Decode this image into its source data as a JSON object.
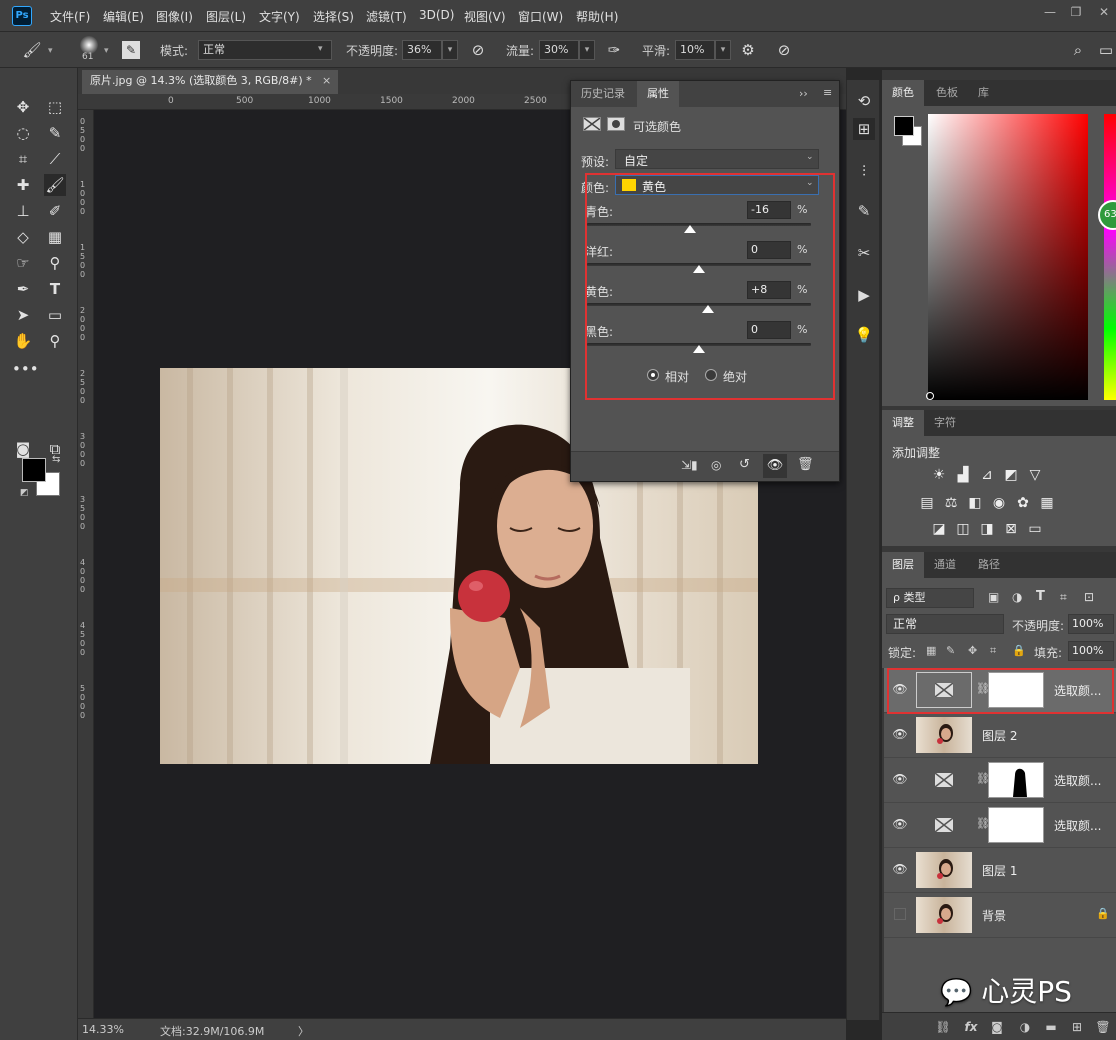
{
  "app": {
    "logo": "Ps",
    "accent": "#31a8ff"
  },
  "menu": [
    "文件(F)",
    "编辑(E)",
    "图像(I)",
    "图层(L)",
    "文字(Y)",
    "选择(S)",
    "滤镜(T)",
    "3D(D)",
    "视图(V)",
    "窗口(W)",
    "帮助(H)"
  ],
  "options": {
    "brush_size": "61",
    "mode_label": "模式:",
    "mode_value": "正常",
    "opacity_label": "不透明度:",
    "opacity_value": "36%",
    "flow_label": "流量:",
    "flow_value": "30%",
    "smooth_label": "平滑:",
    "smooth_value": "10%"
  },
  "document": {
    "tab_title": "原片.jpg @ 14.3% (选取颜色 3, RGB/8#) *",
    "ruler_h": [
      "0",
      "500",
      "1000",
      "1500",
      "2000",
      "2500"
    ]
  },
  "status": {
    "zoom": "14.33%",
    "doc_info": "文档:32.9M/106.9M",
    "arrow": "〉"
  },
  "properties": {
    "tabs": [
      "历史记录",
      "属性"
    ],
    "active_tab": 1,
    "title": "可选颜色",
    "preset_label": "预设:",
    "preset_value": "自定",
    "color_label": "颜色:",
    "color_value": "黄色",
    "color_swatch": "#ffd400",
    "sliders": [
      {
        "label": "青色:",
        "value": "-16",
        "unit": "%",
        "position": 0.46
      },
      {
        "label": "洋红:",
        "value": "0",
        "unit": "%",
        "position": 0.5
      },
      {
        "label": "黄色:",
        "value": "+8",
        "unit": "%",
        "position": 0.54
      },
      {
        "label": "黑色:",
        "value": "0",
        "unit": "%",
        "position": 0.5
      }
    ],
    "method_relative": "相对",
    "method_absolute": "绝对",
    "highlight_color": "#e03232"
  },
  "color_panel": {
    "tabs": [
      "颜色",
      "色板",
      "库"
    ],
    "badge": "63"
  },
  "adjust_panel": {
    "tabs": [
      "调整",
      "字符"
    ],
    "heading": "添加调整"
  },
  "layers_panel": {
    "tabs": [
      "图层",
      "通道",
      "路径"
    ],
    "filter_value": "ρ 类型",
    "blend_mode": "正常",
    "opacity_label": "不透明度:",
    "opacity_value": "100%",
    "lock_label": "锁定:",
    "fill_label": "填充:",
    "fill_value": "100%",
    "layers": [
      {
        "name": "选取颜...",
        "type": "adjustment",
        "mask": "white",
        "selected": true,
        "visible": true
      },
      {
        "name": "图层 2",
        "type": "photo",
        "selected": false,
        "visible": true
      },
      {
        "name": "选取颜...",
        "type": "adjustment",
        "mask": "silhouette",
        "selected": false,
        "visible": true
      },
      {
        "name": "选取颜...",
        "type": "adjustment",
        "mask": "white",
        "selected": false,
        "visible": true
      },
      {
        "name": "图层 1",
        "type": "photo",
        "selected": false,
        "visible": true
      },
      {
        "name": "背景",
        "type": "photo",
        "selected": false,
        "visible": false,
        "locked": true
      }
    ]
  },
  "watermark": "心灵PS"
}
